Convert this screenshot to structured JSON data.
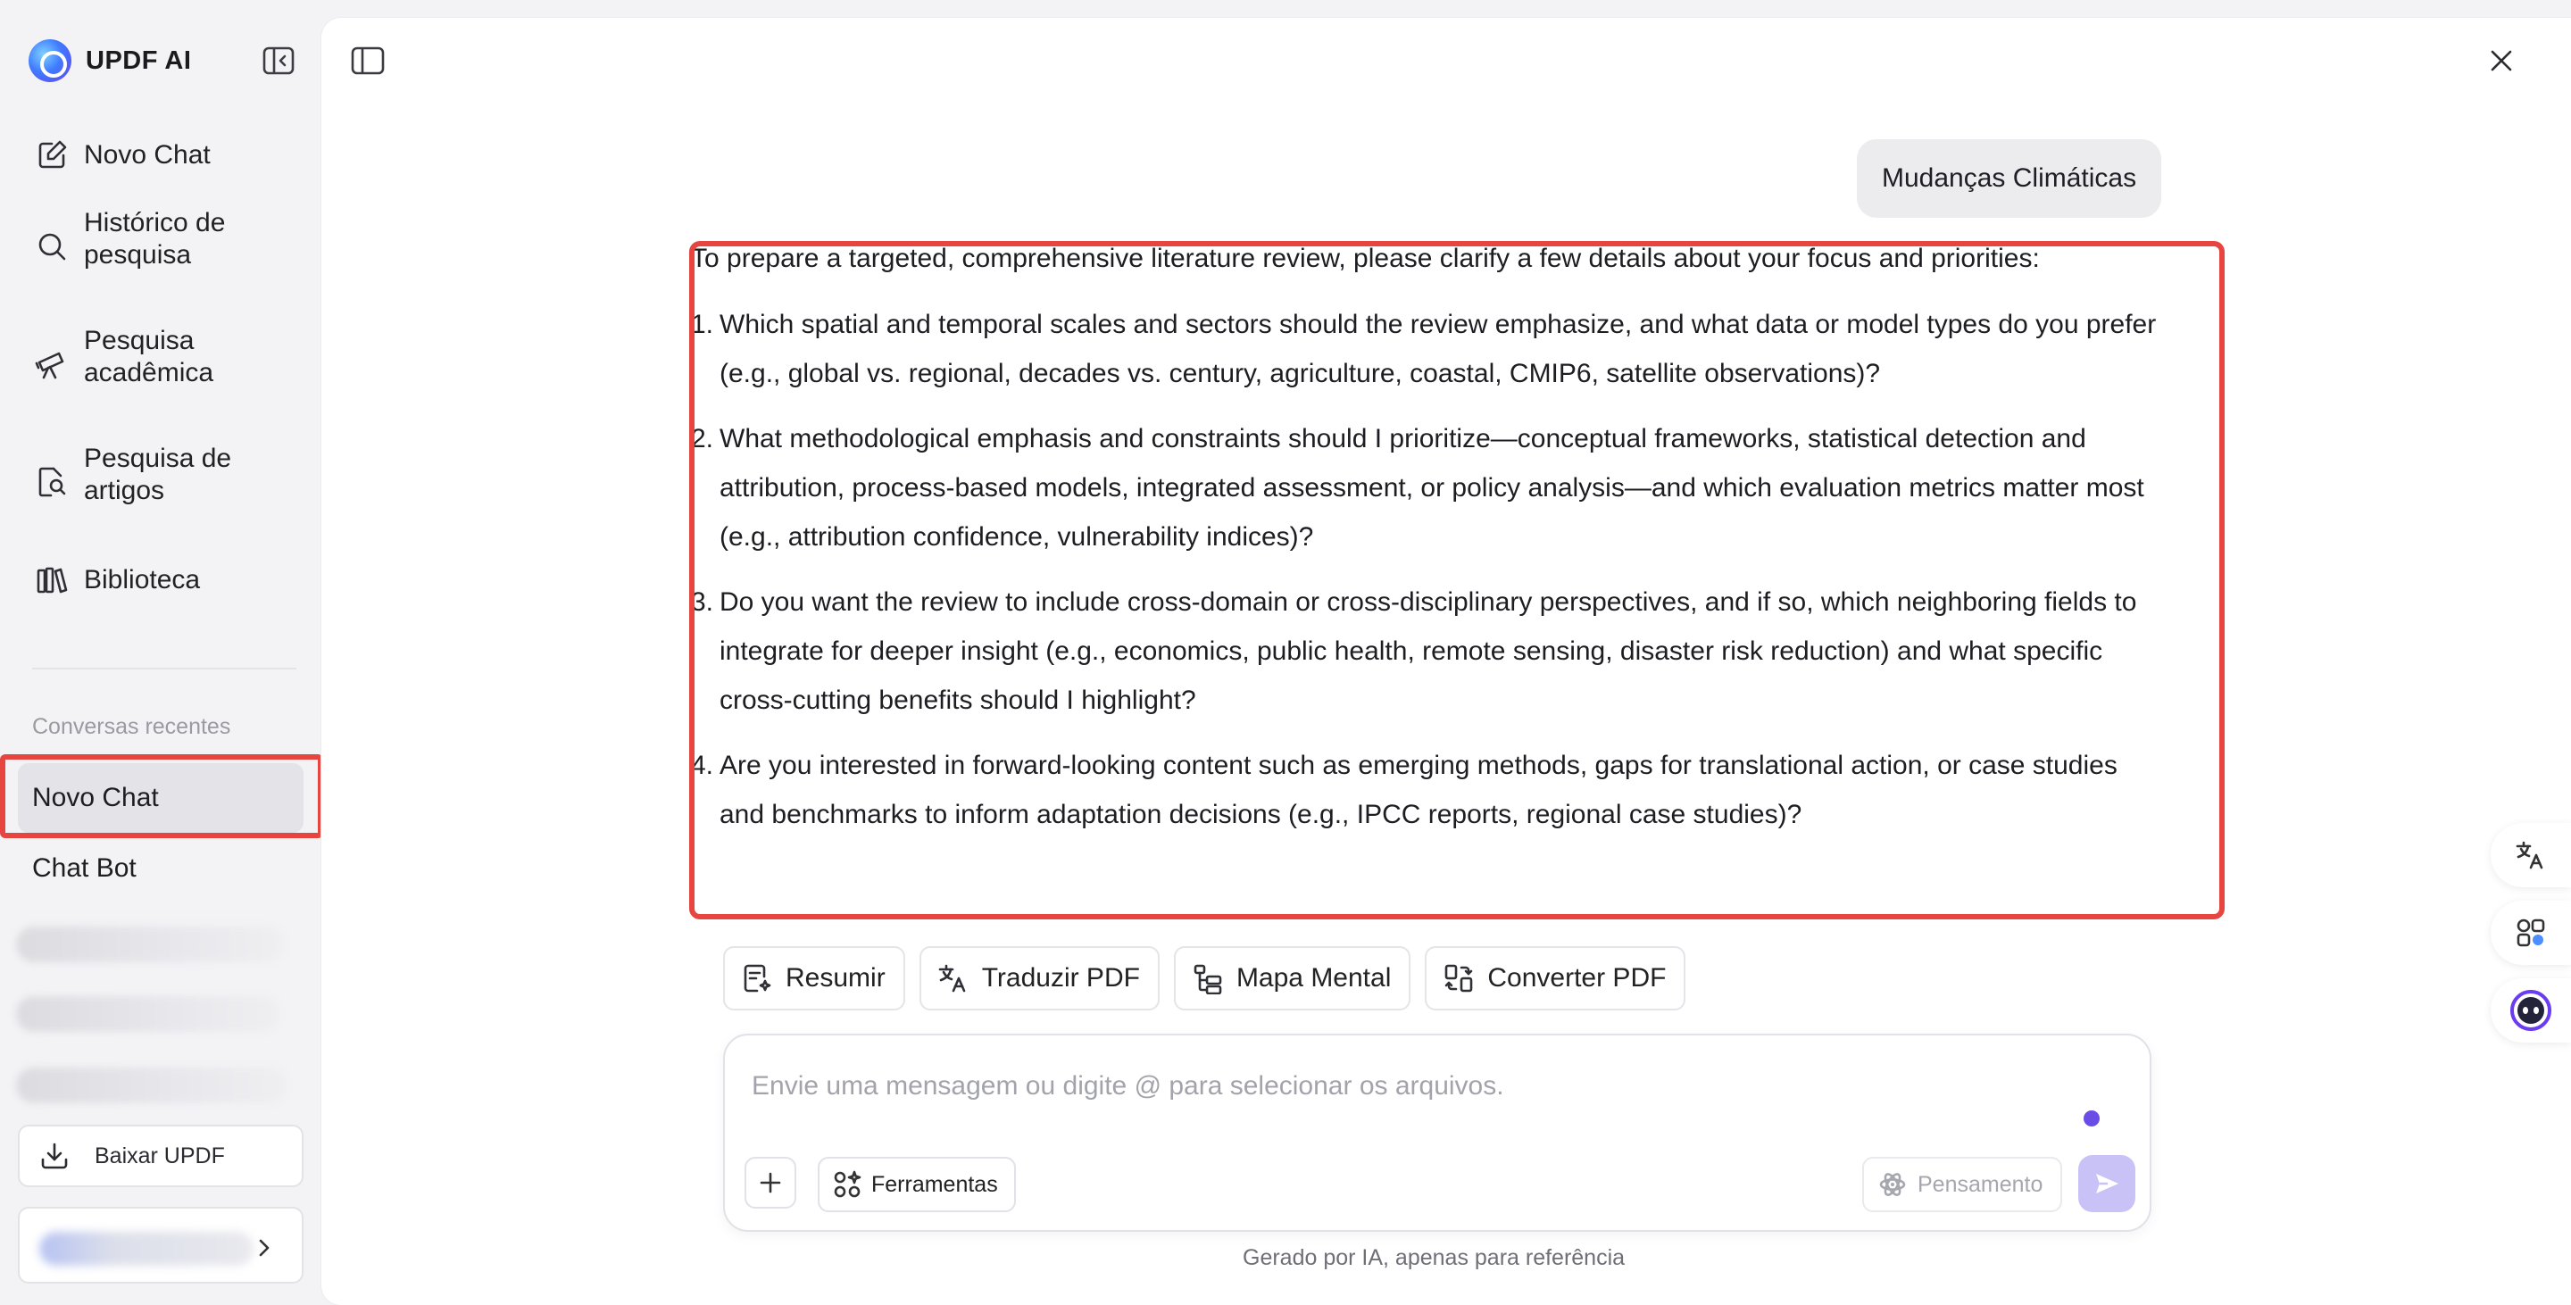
{
  "app": {
    "name": "UPDF AI"
  },
  "sidebar": {
    "nav": [
      {
        "label": "Novo Chat",
        "icon": "edit-icon"
      },
      {
        "label": "Histórico de pesquisa",
        "icon": "search-icon"
      },
      {
        "label": "Pesquisa acadêmica",
        "icon": "telescope-icon"
      },
      {
        "label": "Pesquisa de artigos",
        "icon": "document-search-icon"
      },
      {
        "label": "Biblioteca",
        "icon": "library-icon"
      }
    ],
    "recent_title": "Conversas recentes",
    "recent": [
      {
        "label": "Novo Chat",
        "active": true
      },
      {
        "label": "Chat Bot",
        "active": false
      }
    ],
    "download_label": "Baixar UPDF"
  },
  "chat": {
    "user_message": "Mudanças Climáticas",
    "answer_intro": "To prepare a targeted, comprehensive literature review, please clarify a few details about your focus and priorities:",
    "answer_items": [
      "Which spatial and temporal scales and sectors should the review emphasize, and what data or model types do you prefer (e.g., global vs. regional, decades vs. century, agriculture, coastal, CMIP6, satellite observations)?",
      "What methodological emphasis and constraints should I prioritize—conceptual frameworks, statistical detection and attribution, process-based models, integrated assessment, or policy analysis—and which evaluation metrics matter most (e.g., attribution confidence, vulnerability indices)?",
      "Do you want the review to include cross-domain or cross-disciplinary perspectives, and if so, which neighboring fields to integrate for deeper insight (e.g., economics, public health, remote sensing, disaster risk reduction) and what specific cross-cutting benefits should I highlight?",
      "Are you interested in forward-looking content such as emerging methods, gaps for translational action, or case studies and benchmarks to inform adaptation decisions (e.g., IPCC reports, regional case studies)?"
    ],
    "item_numbers": [
      "1.",
      "2.",
      "3.",
      "4."
    ]
  },
  "quick_tools": [
    {
      "label": "Resumir",
      "icon": "summarize-icon"
    },
    {
      "label": "Traduzir PDF",
      "icon": "translate-icon"
    },
    {
      "label": "Mapa Mental",
      "icon": "mindmap-icon"
    },
    {
      "label": "Converter PDF",
      "icon": "convert-icon"
    }
  ],
  "composer": {
    "placeholder": "Envie uma mensagem ou digite @ para selecionar os arquivos.",
    "tools_label": "Ferramentas",
    "thinking_label": "Pensamento"
  },
  "footer_note": "Gerado por IA, apenas para referência",
  "colors": {
    "highlight": "#e64540",
    "accent": "#6a4ce6",
    "send_disabled": "#c9c2f6"
  }
}
